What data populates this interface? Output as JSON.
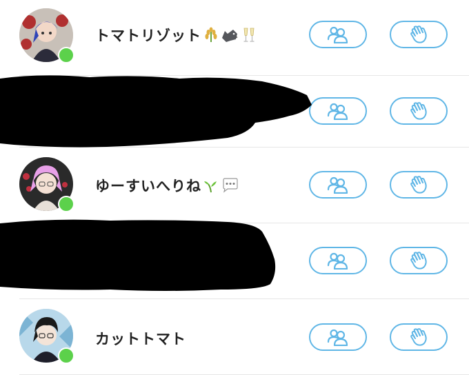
{
  "rows": [
    {
      "name": "トマトリゾット",
      "emoji_names": [
        "rice-emoji",
        "wolf-emoji",
        "champagne-emoji"
      ],
      "online": true,
      "redacted": false
    },
    {
      "name": "",
      "emoji_names": [],
      "online": true,
      "redacted": true
    },
    {
      "name": "ゆーすいへりね",
      "emoji_names": [
        "seedling-emoji",
        "speech-bubble-emoji"
      ],
      "online": true,
      "redacted": false
    },
    {
      "name": "",
      "emoji_names": [],
      "online": true,
      "redacted": true
    },
    {
      "name": "カットトマト",
      "emoji_names": [],
      "online": true,
      "redacted": false
    }
  ],
  "icons": {
    "friend_button_icon": "friends-icon",
    "wave_button_icon": "wave-hand-icon"
  },
  "colors": {
    "accent": "#5fb6e6",
    "online": "#5cd14b",
    "divider": "#e6e6e6",
    "text": "#222222"
  }
}
